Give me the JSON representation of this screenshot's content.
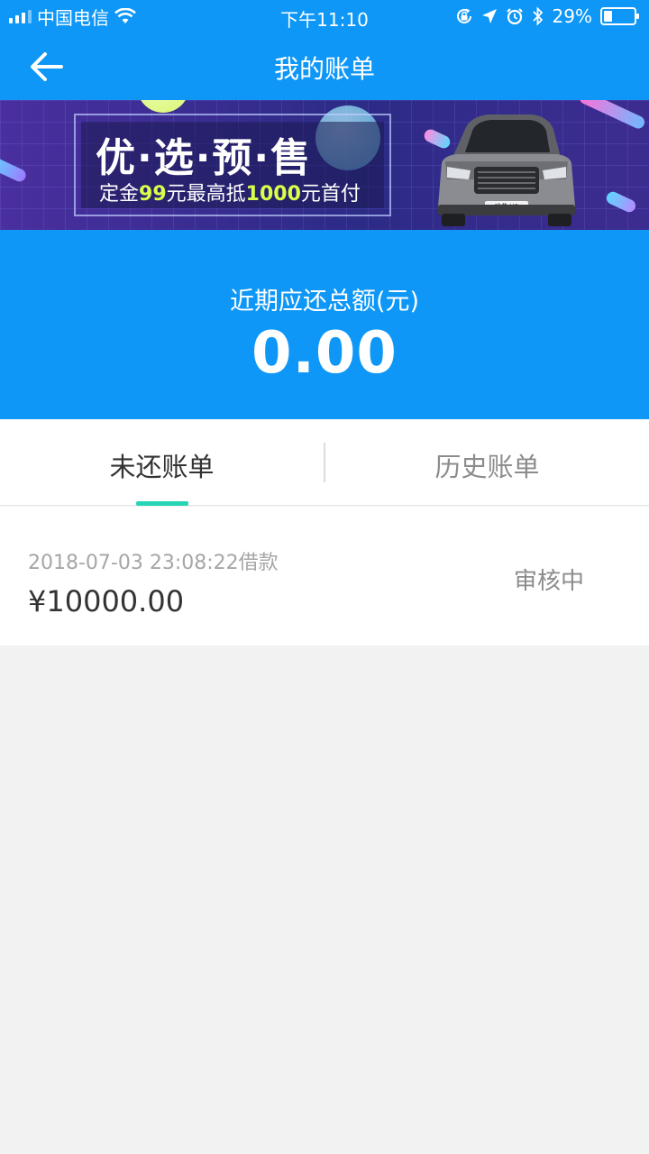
{
  "status_bar": {
    "carrier": "中国电信",
    "time": "下午11:10",
    "battery_text": "29%",
    "battery_level": 0.29
  },
  "nav": {
    "title": "我的账单",
    "back_icon": "arrow-left-icon"
  },
  "banner": {
    "headline": "优·选·预·售",
    "sub_prefix": "定金",
    "sub_deposit": "99",
    "sub_mid": "元最高抵",
    "sub_credit": "1000",
    "sub_suffix": "元首付",
    "car_badge": "哈弗 H6"
  },
  "summary": {
    "label": "近期应还总额(元)",
    "amount": "0.00"
  },
  "tabs": [
    {
      "label": "未还账单",
      "active": true
    },
    {
      "label": "历史账单",
      "active": false
    }
  ],
  "bills": [
    {
      "datetime": "2018-07-03 23:08:22借款",
      "amount": "¥10000.00",
      "status": "审核中"
    }
  ],
  "colors": {
    "primary": "#0e97f7",
    "tab_indicator": "#25d5b3",
    "page_bg": "#f2f2f2"
  }
}
